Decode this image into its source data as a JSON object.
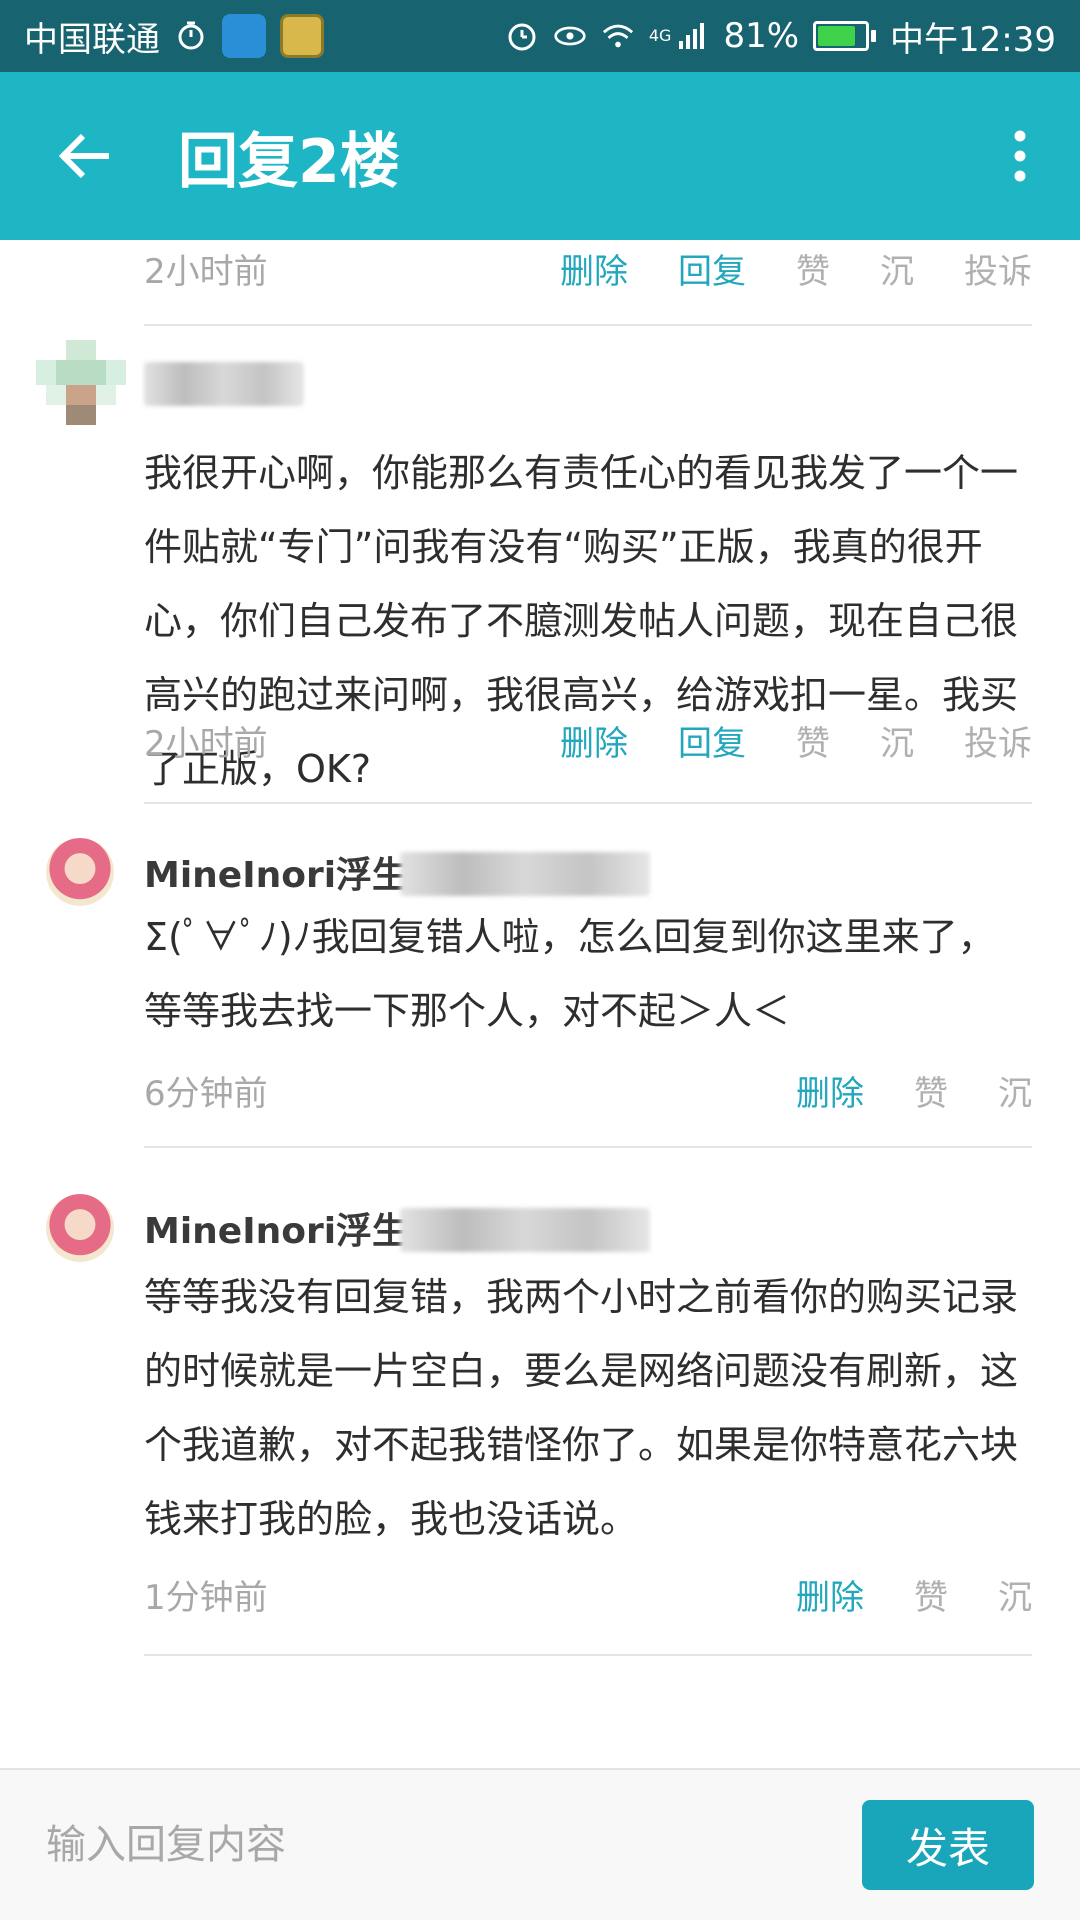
{
  "status_bar": {
    "carrier": "中国联通",
    "network": "4G",
    "battery": "81%",
    "time": "中午12:39",
    "battery_level": 0.81
  },
  "app_bar": {
    "title": "回复2楼"
  },
  "top_row": {
    "time": "2小时前",
    "actions": [
      "删除",
      "回复",
      "赞",
      "沉",
      "投诉"
    ]
  },
  "comments": [
    {
      "text": "我很开心啊，你能那么有责任心的看见我发了一个一件贴就“专门”问我有没有“购买”正版，我真的很开心，你们自己发布了不臆测发帖人问题，现在自己很高兴的跑过来问啊，我很高兴，给游戏扣一星。我买了正版，OK?",
      "time": "2小时前",
      "actions": [
        "删除",
        "回复",
        "赞",
        "沉",
        "投诉"
      ]
    },
    {
      "user": "MineInori浮生",
      "text": "Σ(ﾟ∀ﾟﾉ)ﾉ我回复错人啦，怎么回复到你这里来了，等等我去找一下那个人，对不起＞人＜",
      "time": "6分钟前",
      "actions": [
        "删除",
        "赞",
        "沉"
      ]
    },
    {
      "user": "MineInori浮生",
      "text": "等等我没有回复错，我两个小时之前看你的购买记录的时候就是一片空白，要么是网络问题没有刷新，这个我道歉，对不起我错怪你了。如果是你特意花六块钱来打我的脸，我也没话说。",
      "time": "1分钟前",
      "actions": [
        "删除",
        "赞",
        "沉"
      ]
    }
  ],
  "reply_box": {
    "placeholder": "输入回复内容",
    "send_label": "发表"
  },
  "colors": {
    "status_bar": "#17636f",
    "app_bar": "#1eb5c4",
    "accent": "#22a7bd",
    "send_button": "#19a6ba"
  }
}
